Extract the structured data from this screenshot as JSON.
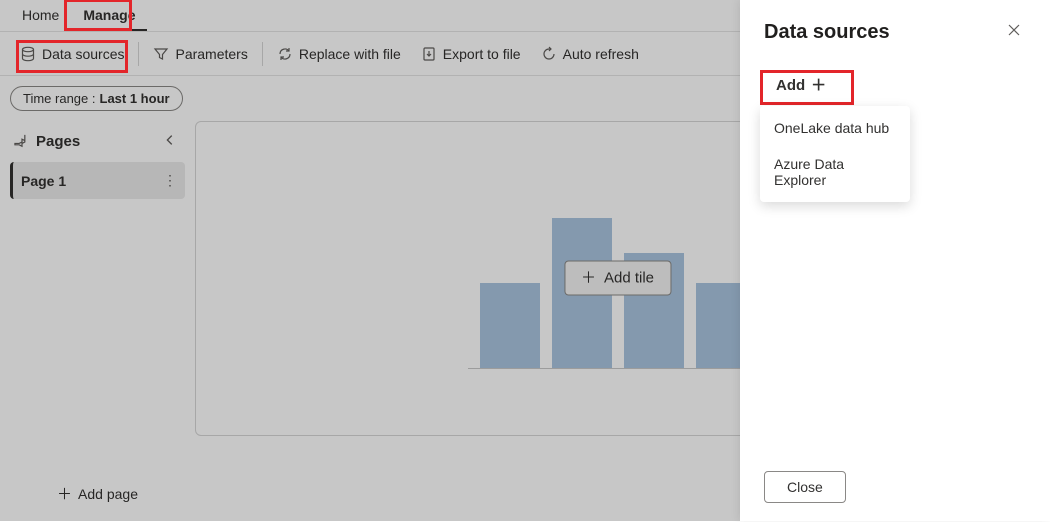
{
  "tabs": {
    "home": "Home",
    "manage": "Manage"
  },
  "toolbar": {
    "data_sources": "Data sources",
    "parameters": "Parameters",
    "replace": "Replace with file",
    "export": "Export to file",
    "auto_refresh": "Auto refresh"
  },
  "filter": {
    "label": "Time range :",
    "value": "Last 1 hour"
  },
  "sidebar": {
    "title": "Pages",
    "pages": [
      {
        "label": "Page 1"
      }
    ],
    "add_page": "Add page"
  },
  "canvas": {
    "add_tile": "Add tile"
  },
  "panel": {
    "title": "Data sources",
    "add": "Add",
    "options": [
      "OneLake data hub",
      "Azure Data Explorer"
    ],
    "close": "Close"
  },
  "highlight_color": "#e3252a"
}
